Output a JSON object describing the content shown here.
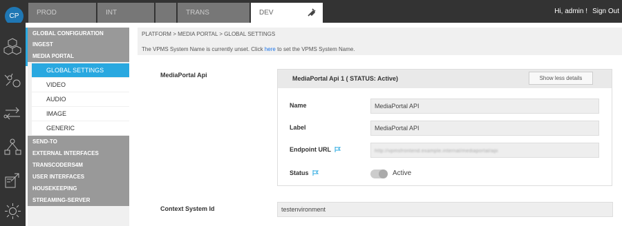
{
  "header": {
    "logo": "CP",
    "tabs": [
      {
        "label": "PROD"
      },
      {
        "label": "INT"
      },
      {
        "label": ""
      },
      {
        "label": "TRANS"
      },
      {
        "label": "DEV"
      }
    ],
    "greeting": "Hi, admin !",
    "sign_out": "Sign Out"
  },
  "sidebar": {
    "icons": [
      "cubes-icon",
      "network-settings-icon",
      "transfer-icon",
      "workflow-icon",
      "export-icon",
      "gear-icon"
    ],
    "sections": [
      {
        "label": "GLOBAL CONFIGURATION"
      },
      {
        "label": "INGEST"
      },
      {
        "label": "MEDIA PORTAL"
      }
    ],
    "media_portal_items": [
      {
        "label": "GLOBAL SETTINGS"
      },
      {
        "label": "VIDEO"
      },
      {
        "label": "AUDIO"
      },
      {
        "label": "IMAGE"
      },
      {
        "label": "GENERIC"
      }
    ],
    "sections_after": [
      {
        "label": "SEND-TO"
      },
      {
        "label": "EXTERNAL INTERFACES"
      },
      {
        "label": "TRANSCODERS4M"
      },
      {
        "label": "USER INTERFACES"
      },
      {
        "label": "HOUSEKEEPING"
      },
      {
        "label": "STREAMING-SERVER"
      }
    ]
  },
  "breadcrumb": "PLATFORM > MEDIA PORTAL > GLOBAL SETTINGS",
  "notice": {
    "before": "The VPMS System Name is currently unset. Click ",
    "link": "here",
    "after": " to set the VPMS System Name."
  },
  "main": {
    "mediaportal_api_label": "MediaPortal Api",
    "panel_title": "MediaPortal Api 1 ( STATUS: Active)",
    "show_less_label": "Show less details",
    "fields": {
      "name_label": "Name",
      "name_value": "MediaPortal API",
      "label_label": "Label",
      "label_value": "MediaPortal API",
      "endpoint_label": "Endpoint URL",
      "endpoint_value": "http://vpmsfrontend.example.internal/mediaportal/api",
      "status_label": "Status",
      "status_value": "Active"
    },
    "context_label": "Context System Id",
    "context_value": "testenvironment"
  }
}
